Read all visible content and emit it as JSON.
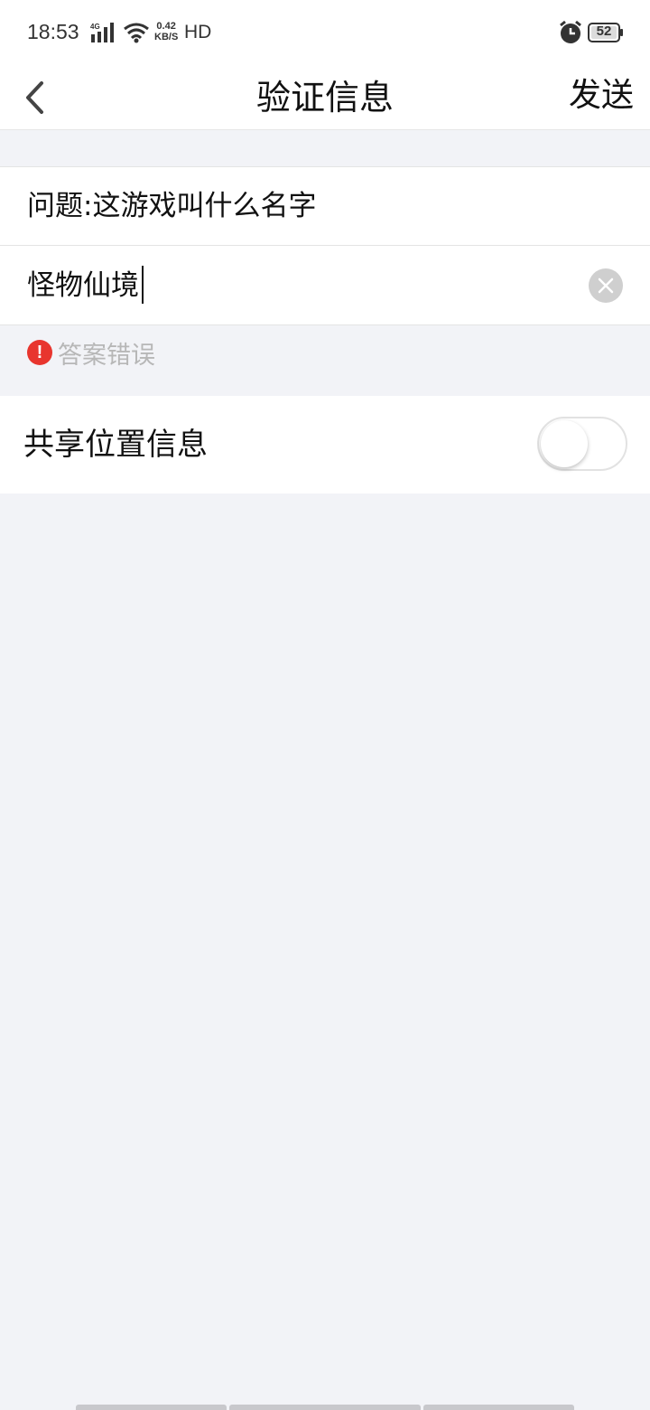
{
  "status_bar": {
    "time": "18:53",
    "network_type": "4G",
    "speed_value": "0.42",
    "speed_unit": "KB/S",
    "hd_label": "HD",
    "battery_level": "52"
  },
  "header": {
    "title": "验证信息",
    "send_label": "发送"
  },
  "verification": {
    "question": "问题:这游戏叫什么名字",
    "answer_value": "怪物仙境",
    "error_text": "答案错误"
  },
  "settings": {
    "share_location_label": "共享位置信息",
    "share_location_on": false
  },
  "colors": {
    "error_red": "#e8352e",
    "page_bg": "#f2f3f7"
  }
}
